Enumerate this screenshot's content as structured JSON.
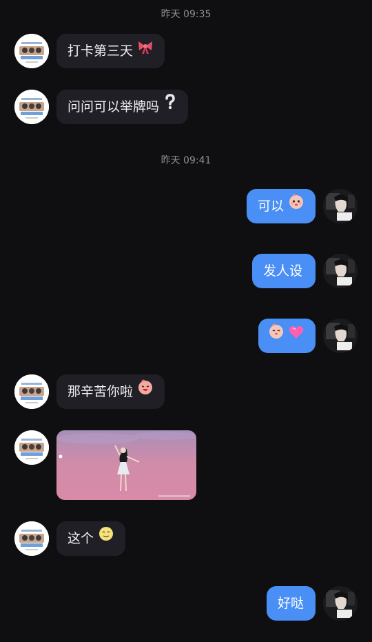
{
  "timestamps": [
    "昨天 09:35",
    "昨天 09:41"
  ],
  "messages": {
    "m1": "打卡第三天",
    "m2": "问问可以举牌吗",
    "m3": "可以",
    "m4": "发人设",
    "m6": "那辛苦你啦",
    "m8": "这个",
    "m9": "好哒"
  },
  "icons": {
    "m1": "bow-emoji",
    "m2": "question-mark-emoji",
    "m3": "peach-face-emoji",
    "m5": [
      "peach-face-emoji",
      "pink-heart-emoji"
    ],
    "m6": "peach-face-emoji",
    "m8": "smiling-face-emoji"
  },
  "colors": {
    "background": "#0f0f12",
    "incoming_bubble": "#1f1f25",
    "outgoing_bubble": "#4a8ff5",
    "timestamp_text": "#8f8f96"
  }
}
